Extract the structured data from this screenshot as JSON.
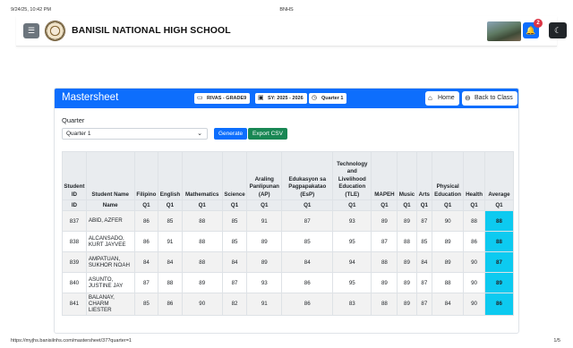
{
  "print": {
    "datetime": "9/24/25, 10:42 PM",
    "page_title": "BNHS",
    "url": "https://myjhs.banisilnhs.com/mastersheet/37?quarter=1",
    "page_number": "1/5"
  },
  "navbar": {
    "menu_icon": "☰",
    "school_name": "BANISIL NATIONAL HIGH SCHOOL",
    "notification_count": "2",
    "bell_icon": "🔔",
    "moon_icon": "☾"
  },
  "card": {
    "title": "Mastersheet",
    "pills": [
      {
        "icon": "▭",
        "label": "RIVAS - GRADE9"
      },
      {
        "icon": "▣",
        "label": "SY: 2025 - 2026"
      },
      {
        "icon": "◷",
        "label": "Quarter 1"
      }
    ],
    "home_label": "Home",
    "home_icon": "⌂",
    "back_label": "Back to Class",
    "back_icon": "⊖"
  },
  "controls": {
    "quarter_label": "Quarter",
    "quarter_value": "Quarter 1",
    "generate_label": "Generate",
    "export_label": "Export CSV"
  },
  "table": {
    "headers": [
      "Student ID",
      "Student Name",
      "Filipino",
      "English",
      "Mathematics",
      "Science",
      "Araling Panlipunan (AP)",
      "Edukasyon sa Pagpapakatao (EsP)",
      "Technology and Livelihood Education (TLE)",
      "MAPEH",
      "Music",
      "Arts",
      "Physical Education",
      "Health",
      "Average"
    ],
    "subheaders": [
      "ID",
      "Name",
      "Q1",
      "Q1",
      "Q1",
      "Q1",
      "Q1",
      "Q1",
      "Q1",
      "Q1",
      "Q1",
      "Q1",
      "Q1",
      "Q1",
      "Q1"
    ],
    "rows": [
      {
        "id": "837",
        "name": "ABID, AZFER",
        "grades": [
          "86",
          "85",
          "88",
          "85",
          "91",
          "87",
          "93",
          "89",
          "89",
          "87",
          "90",
          "88"
        ],
        "average": "88"
      },
      {
        "id": "838",
        "name": "ALCANSADO, KURT JAYVEE",
        "grades": [
          "86",
          "91",
          "88",
          "85",
          "89",
          "85",
          "95",
          "87",
          "88",
          "85",
          "89",
          "86"
        ],
        "average": "88"
      },
      {
        "id": "839",
        "name": "AMPATUAN, SUKHOR NOAH",
        "grades": [
          "84",
          "84",
          "88",
          "84",
          "89",
          "84",
          "94",
          "88",
          "89",
          "84",
          "89",
          "90"
        ],
        "average": "87"
      },
      {
        "id": "840",
        "name": "ASUNTO, JUSTINE JAY",
        "grades": [
          "87",
          "88",
          "89",
          "87",
          "93",
          "86",
          "95",
          "89",
          "89",
          "87",
          "88",
          "90"
        ],
        "average": "89"
      },
      {
        "id": "841",
        "name": "BALANAY, CHARM LIESTER",
        "grades": [
          "85",
          "86",
          "90",
          "82",
          "91",
          "86",
          "83",
          "88",
          "89",
          "87",
          "84",
          "90"
        ],
        "average": "86"
      }
    ]
  },
  "colors": {
    "primary": "#0d6efd",
    "success": "#198754",
    "average_cell": "#0dcaf0",
    "badge": "#dc3545"
  }
}
